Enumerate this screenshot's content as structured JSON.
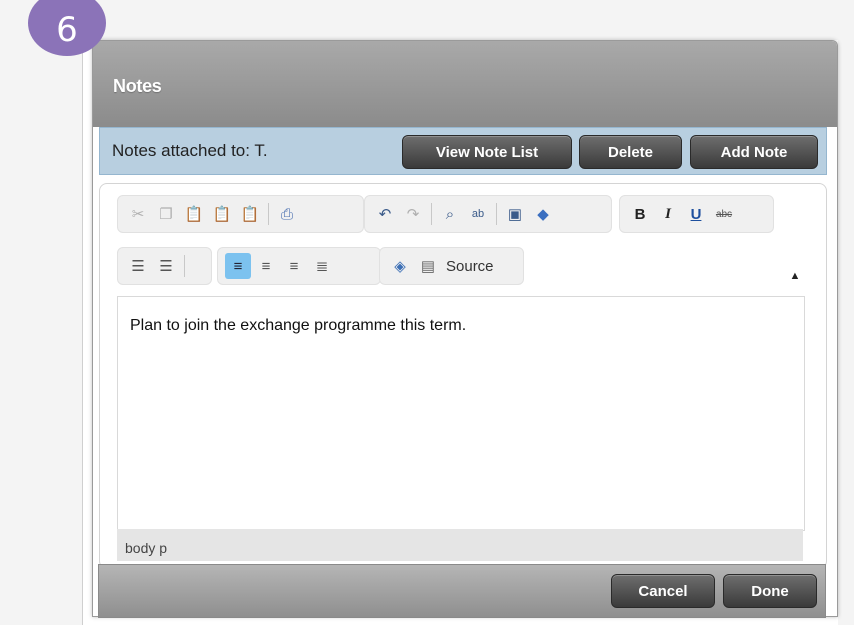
{
  "step_badge": "6",
  "dialog": {
    "title": "Notes",
    "attached_label": "Notes attached to:  T.",
    "buttons": {
      "view_note_list": "View Note List",
      "delete": "Delete",
      "add_note": "Add Note"
    },
    "toolbar": {
      "row1_group1": [
        "cut-icon",
        "copy-icon",
        "paste-icon",
        "paste-text-icon",
        "paste-word-icon",
        "print-icon"
      ],
      "row1_group2": [
        "undo-icon",
        "redo-icon",
        "find-icon",
        "replace-icon",
        "select-all-icon",
        "remove-format-icon"
      ],
      "row1_group3": [
        "bold-icon",
        "italic-icon",
        "underline-icon",
        "strikethrough-icon"
      ],
      "row2_group1": [
        "numbered-list-icon",
        "bulleted-list-icon"
      ],
      "row2_group2": [
        "align-left-icon",
        "align-center-icon",
        "align-right-icon",
        "justify-icon"
      ],
      "row2_group3": [
        "image-icon",
        "source-icon"
      ],
      "source_label": "Source"
    },
    "editor_text": "Plan to join the exchange programme this term.",
    "element_path": "body  p",
    "footer_buttons": {
      "cancel": "Cancel",
      "done": "Done"
    }
  },
  "colors": {
    "badge": "#8b73b8",
    "attach_bar": "#b8cfe0",
    "active_tool": "#7cc2ef"
  }
}
